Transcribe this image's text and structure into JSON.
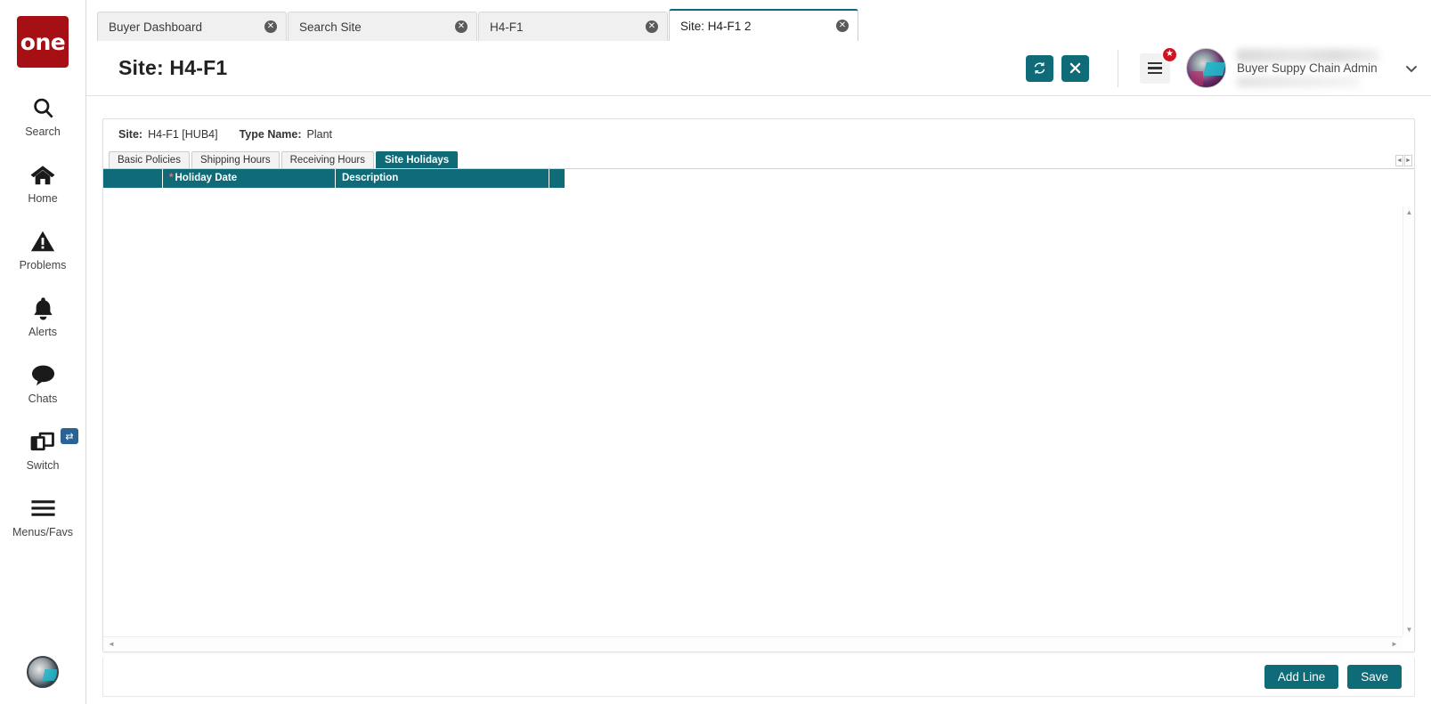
{
  "brand": {
    "logo_text": "one",
    "logo_color": "#a60f14"
  },
  "theme": {
    "accent": "#0f6b77",
    "tab_active_border": "#0b6b7a",
    "badge_red": "#cf1322",
    "required_marker": "#ff6b6b"
  },
  "sidebar": {
    "items": [
      {
        "label": "Search",
        "icon": "search-icon"
      },
      {
        "label": "Home",
        "icon": "home-icon"
      },
      {
        "label": "Problems",
        "icon": "warning-triangle-icon"
      },
      {
        "label": "Alerts",
        "icon": "bell-icon"
      },
      {
        "label": "Chats",
        "icon": "chat-bubble-icon"
      },
      {
        "label": "Switch",
        "icon": "windows-stack-icon",
        "badge_icon": "swap-arrows-icon"
      },
      {
        "label": "Menus/Favs",
        "icon": "hamburger-icon"
      }
    ]
  },
  "browser_tabs": [
    {
      "label": "Buyer Dashboard",
      "active": false
    },
    {
      "label": "Search Site",
      "active": false
    },
    {
      "label": "H4-F1",
      "active": false
    },
    {
      "label": "Site: H4-F1 2",
      "active": true
    }
  ],
  "header": {
    "title": "Site: H4-F1",
    "refresh_icon": "refresh-icon",
    "close_icon": "close-x-icon",
    "menu_icon": "hamburger-menu-icon",
    "star_badge_icon": "star-icon",
    "avatar_icon": "user-avatar",
    "user_role": "Buyer Suppy Chain Admin",
    "chevron_icon": "chevron-down-icon"
  },
  "info": {
    "site_label": "Site:",
    "site_value": "H4-F1 [HUB4]",
    "type_label": "Type Name:",
    "type_value": "Plant"
  },
  "form_tabs": [
    {
      "label": "Basic Policies",
      "active": false
    },
    {
      "label": "Shipping Hours",
      "active": false
    },
    {
      "label": "Receiving Hours",
      "active": false
    },
    {
      "label": "Site Holidays",
      "active": true
    }
  ],
  "grid": {
    "columns": [
      {
        "label": "",
        "required": false
      },
      {
        "label": "Holiday Date",
        "required": true
      },
      {
        "label": "Description",
        "required": false
      },
      {
        "label": "",
        "required": false
      }
    ],
    "rows": []
  },
  "footer": {
    "add_line_label": "Add Line",
    "save_label": "Save"
  },
  "scroll": {
    "up_arrow": "▲",
    "down_arrow": "▼",
    "left_arrow": "◄",
    "right_arrow": "►"
  }
}
